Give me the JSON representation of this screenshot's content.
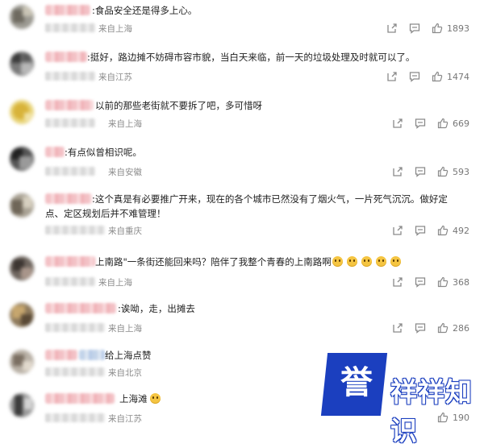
{
  "comments": [
    {
      "text": ":食品安全还是得多上心。",
      "location": "来自上海",
      "likes": "1893"
    },
    {
      "text": ":挺好，路边摊不妨碍市容市貌，当白天来临，前一天的垃圾处理及时就可以了。",
      "location": "来自江苏",
      "likes": "1474"
    },
    {
      "text": "以前的那些老街就不要拆了吧，多可惜呀",
      "location": "来自上海",
      "likes": "669"
    },
    {
      "text": ":有点似曾相识呢。",
      "location": "来自安徽",
      "likes": "593"
    },
    {
      "text": ":这个真是有必要推广开来，现在的各个城市已然没有了烟火气，一片死气沉沉。做好定点、定区规划后并不难管理！",
      "location": "来自重庆",
      "likes": "492"
    },
    {
      "text": "上南路\"一条街还能回来吗？陪伴了我整个青春的上南路啊",
      "location": "来自上海",
      "likes": "368"
    },
    {
      "text": ":诶呦，走，出摊去",
      "location": "来自上海",
      "likes": "286"
    },
    {
      "text": "给上海点赞",
      "location": "来自北京",
      "likes": ""
    },
    {
      "text": "上海滩",
      "location": "来自江苏",
      "likes": "190"
    }
  ],
  "icons": {
    "share": "share-icon",
    "comment": "comment-icon",
    "like": "like-icon"
  },
  "watermark": {
    "badge": "誉",
    "text": "祥祥知识",
    "color": "#1b3fbf"
  }
}
